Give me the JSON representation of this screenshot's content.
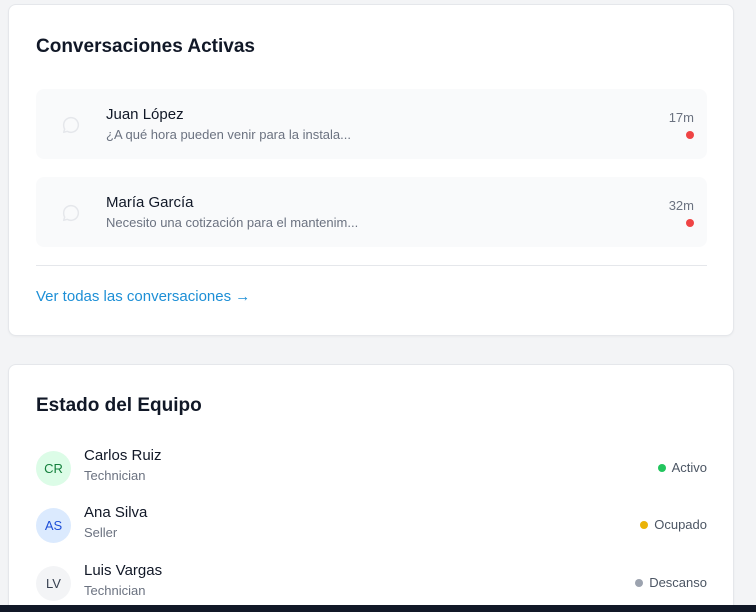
{
  "conversations": {
    "title": "Conversaciones Activas",
    "items": [
      {
        "name": "Juan López",
        "message": "¿A qué hora pueden venir para la instala...",
        "time": "17m",
        "unread_color": "#ef4444",
        "icon": "chat-bubble-icon"
      },
      {
        "name": "María García",
        "message": "Necesito una cotización para el mantenim...",
        "time": "32m",
        "unread_color": "#ef4444",
        "icon": "chat-bubble-icon"
      }
    ],
    "view_all": "Ver todas las conversaciones →"
  },
  "team": {
    "title": "Estado del Equipo",
    "members": [
      {
        "initials": "CR",
        "name": "Carlos Ruiz",
        "role": "Technician",
        "status": "Activo",
        "status_color": "#22c55e",
        "avatar_bg": "#dcfce7",
        "avatar_fg": "#15803d"
      },
      {
        "initials": "AS",
        "name": "Ana Silva",
        "role": "Seller",
        "status": "Ocupado",
        "status_color": "#eab308",
        "avatar_bg": "#dbeafe",
        "avatar_fg": "#1d4ed8"
      },
      {
        "initials": "LV",
        "name": "Luis Vargas",
        "role": "Technician",
        "status": "Descanso",
        "status_color": "#9ca3af",
        "avatar_bg": "#f3f4f6",
        "avatar_fg": "#374151"
      }
    ]
  }
}
